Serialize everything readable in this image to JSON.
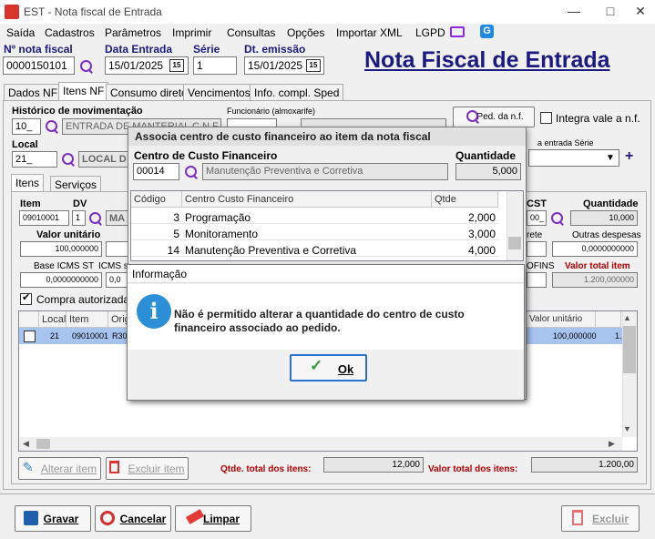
{
  "window": {
    "title": "EST - Nota fiscal de Entrada",
    "minimize": "—",
    "maximize": "□",
    "close": "✕"
  },
  "menu": [
    "Saída",
    "Cadastros",
    "Parâmetros",
    "Imprimir",
    "Consultas",
    "Opções",
    "Importar XML",
    "LGPD"
  ],
  "header": {
    "nota_label": "Nº nota fiscal",
    "nota_value": "0000150101",
    "data_entrada_label": "Data Entrada",
    "data_entrada_value": "15/01/2025",
    "serie_label": "Série",
    "serie_value": "1",
    "dt_emissao_label": "Dt. emissão",
    "dt_emissao_value": "15/01/2025",
    "cal_icon": "15",
    "big_title": "Nota Fiscal de Entrada"
  },
  "tabs": [
    "Dados NF",
    "Itens NF",
    "Consumo direto",
    "Vencimentos",
    "Info. compl. Sped"
  ],
  "itens_nf": {
    "hist_label": "Histórico de movimentação",
    "hist_code": "10_",
    "hist_desc": "ENTRADA DE MANTERIAL C.N.F",
    "func_label": "Funcionário (almoxarife)",
    "ped_btn": "Ped. da n.f.",
    "integra_label": "Integra vale a n.f.",
    "local_label": "Local",
    "local_code": "21_",
    "local_desc": "LOCAL D",
    "conta_label": "a entrada  Série"
  },
  "subtabs": [
    "Itens",
    "Serviços"
  ],
  "item_form": {
    "item_label": "Item",
    "item_value": "09010001",
    "dv_label": "DV",
    "dv_value": "1",
    "desc_value": "MA",
    "cst_label": "CST",
    "cst_value": "00_",
    "qtd_label": "Quantidade",
    "qtd_value": "10,000",
    "valor_unit_label": "Valor unitário",
    "valor_unit_value": "100,000000",
    "frete_label": "rete",
    "outras_label": "Outras despesas",
    "outras_value": "0,0000000000",
    "base_st_label": "Base ICMS ST",
    "base_st_value": "0,0000000000",
    "icms_s_label": "ICMS s",
    "icms_s_value": "0,0",
    "cofins_label": "OFINS",
    "total_item_label": "Valor total item",
    "total_item_value": "1.200,000000",
    "compra_label": "Compra autorizada"
  },
  "items_grid": {
    "headers": [
      "Local",
      "Item",
      "Orig",
      "Valor unitário"
    ],
    "row": {
      "local": "21",
      "item": "09010001",
      "orig": "R30",
      "valor": "100,000000",
      "extra": "1.2"
    }
  },
  "bottom": {
    "alterar": "Alterar item",
    "excluir_item": "Excluir item",
    "qtde_total_label": "Qtde. total dos itens:",
    "qtde_total_value": "12,000",
    "valor_total_label": "Valor total dos itens:",
    "valor_total_value": "1.200,00"
  },
  "footer": {
    "gravar": "Gravar",
    "cancelar": "Cancelar",
    "limpar": "Limpar",
    "excluir": "Excluir"
  },
  "dialog_cc": {
    "title": "Associa centro de custo financeiro ao item da nota fiscal",
    "cc_label": "Centro de Custo Financeiro",
    "cc_code": "00014",
    "cc_desc": "Manutenção Preventiva e Corretiva",
    "qtd_label": "Quantidade",
    "qtd_value": "5,000",
    "headers": [
      "Código",
      "Centro Custo Financeiro",
      "Qtde"
    ],
    "rows": [
      {
        "code": "3",
        "name": "Programação",
        "qtd": "2,000"
      },
      {
        "code": "5",
        "name": "Monitoramento",
        "qtd": "3,000"
      },
      {
        "code": "14",
        "name": "Manutenção Preventiva e Corretiva",
        "qtd": "4,000"
      }
    ]
  },
  "info_dialog": {
    "title": "Informação",
    "message": "Não é permitido alterar a quantidade do centro de custo financeiro associado ao pedido.",
    "ok": "Ok",
    "info_glyph": "i"
  },
  "colors": {
    "accent": "#1a1a80",
    "search": "#7b2fbf",
    "info": "#2b8fd8",
    "selected_row": "#a7c4ef"
  }
}
